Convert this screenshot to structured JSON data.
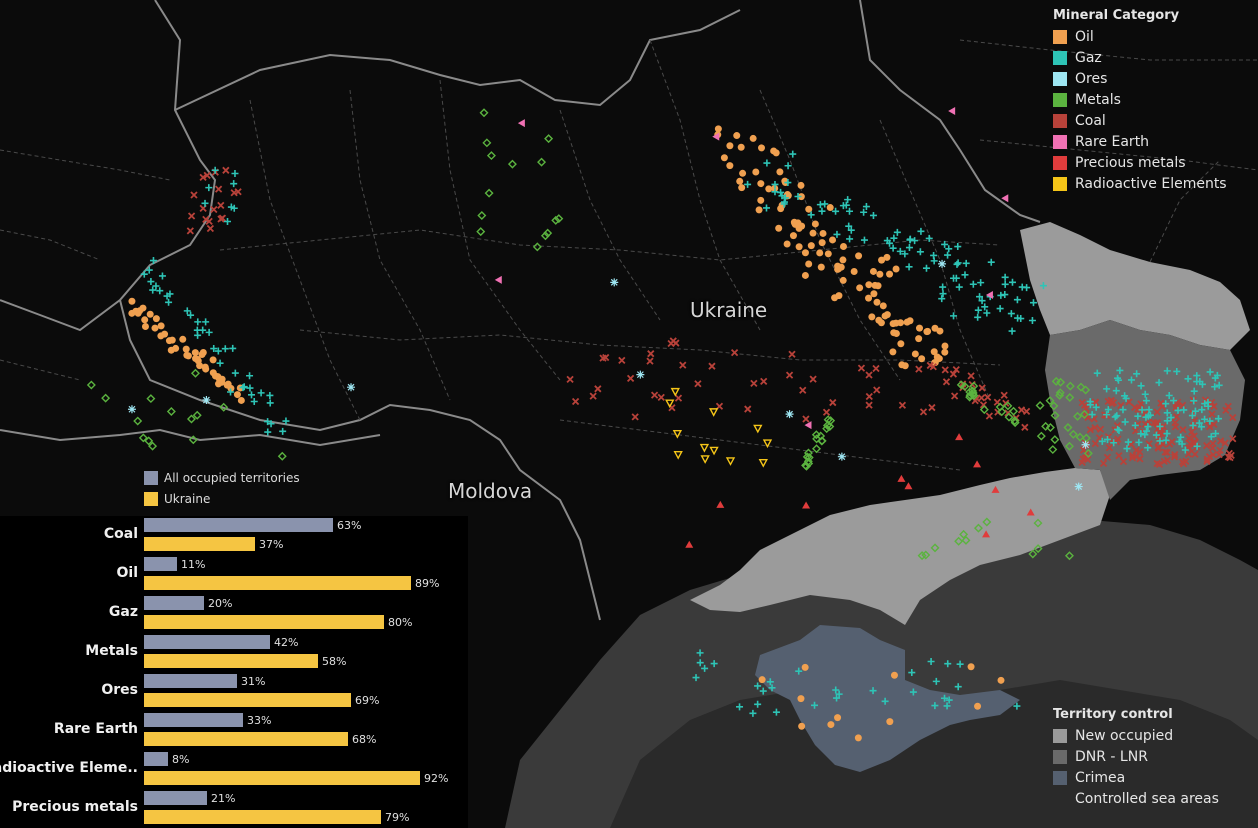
{
  "map": {
    "labels": {
      "ukraine": "Ukraine",
      "moldova": "Moldova"
    },
    "colors": {
      "background": "#0b0b0b",
      "borders": "#8a8a8a",
      "sea": "#3a3a3a"
    }
  },
  "mineral_legend": {
    "title": "Mineral Category",
    "items": [
      {
        "label": "Oil",
        "color": "#f0a050",
        "symbol": "circle"
      },
      {
        "label": "Gaz",
        "color": "#2ec4b6",
        "symbol": "plus"
      },
      {
        "label": "Ores",
        "color": "#9ee6f2",
        "symbol": "asterisk"
      },
      {
        "label": "Metals",
        "color": "#5bb33f",
        "symbol": "diamond"
      },
      {
        "label": "Coal",
        "color": "#b8423a",
        "symbol": "cross"
      },
      {
        "label": "Rare Earth",
        "color": "#f071b4",
        "symbol": "triangle-left"
      },
      {
        "label": "Precious metals",
        "color": "#e03c3c",
        "symbol": "triangle"
      },
      {
        "label": "Radioactive Elements",
        "color": "#f5c518",
        "symbol": "triangle-down"
      }
    ]
  },
  "territory_legend": {
    "title": "Territory control",
    "items": [
      {
        "label": "New occupied",
        "color": "#9b9b9b"
      },
      {
        "label": "DNR - LNR",
        "color": "#6a6a6a"
      },
      {
        "label": "Crimea",
        "color": "#556070"
      },
      {
        "label": "Controlled sea areas",
        "color": "#2a2a2a"
      }
    ]
  },
  "chart_data": {
    "type": "bar",
    "orientation": "horizontal",
    "categories": [
      "Coal",
      "Oil",
      "Gaz",
      "Metals",
      "Ores",
      "Rare Earth",
      "Radioactive Eleme..",
      "Precious metals"
    ],
    "series": [
      {
        "name": "All occupied territories",
        "color": "#8a93ad",
        "values": [
          63,
          11,
          20,
          42,
          31,
          33,
          8,
          21
        ],
        "labels": [
          "63%",
          "11%",
          "20%",
          "42%",
          "31%",
          "33%",
          "8%",
          "21%"
        ]
      },
      {
        "name": "Ukraine",
        "color": "#f5c542",
        "values": [
          37,
          89,
          80,
          58,
          69,
          68,
          92,
          79
        ],
        "labels": [
          "37%",
          "89%",
          "80%",
          "58%",
          "69%",
          "68%",
          "92%",
          "79%"
        ]
      }
    ],
    "xlim": [
      0,
      100
    ],
    "legend": "top-left"
  }
}
